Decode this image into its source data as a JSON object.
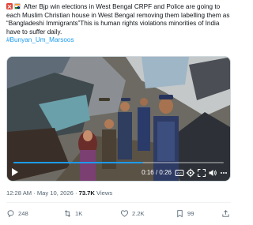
{
  "tweet": {
    "text_main": "After Bjp win elections in West Bengal CRPF  and  Police are going to each Muslim Christian house in West Bengal removing them labelling them as “Bangladeshi Immigrants”This is human rights violations minorities of India have to suffer daily.",
    "hashtag": "#Bunyan_Um_Marsoos",
    "icons": [
      "cross-mark-emoji-icon",
      "india-flag-icon"
    ]
  },
  "video": {
    "current_time": "0:16",
    "separator": "/",
    "duration": "0:26",
    "progress_fraction": 0.6154,
    "accent_color": "#1d9bf0"
  },
  "meta": {
    "timestamp": "12:28 AM · May 10, 2026 ·",
    "views_count": "73.7K",
    "views_label": "Views"
  },
  "actions": {
    "replies": "248",
    "reposts": "1K",
    "likes": "2.2K",
    "bookmarks": "99"
  },
  "colors": {
    "text": "#0f1419",
    "secondary": "#536471",
    "link": "#1d9bf0",
    "border": "#cfd9de"
  }
}
